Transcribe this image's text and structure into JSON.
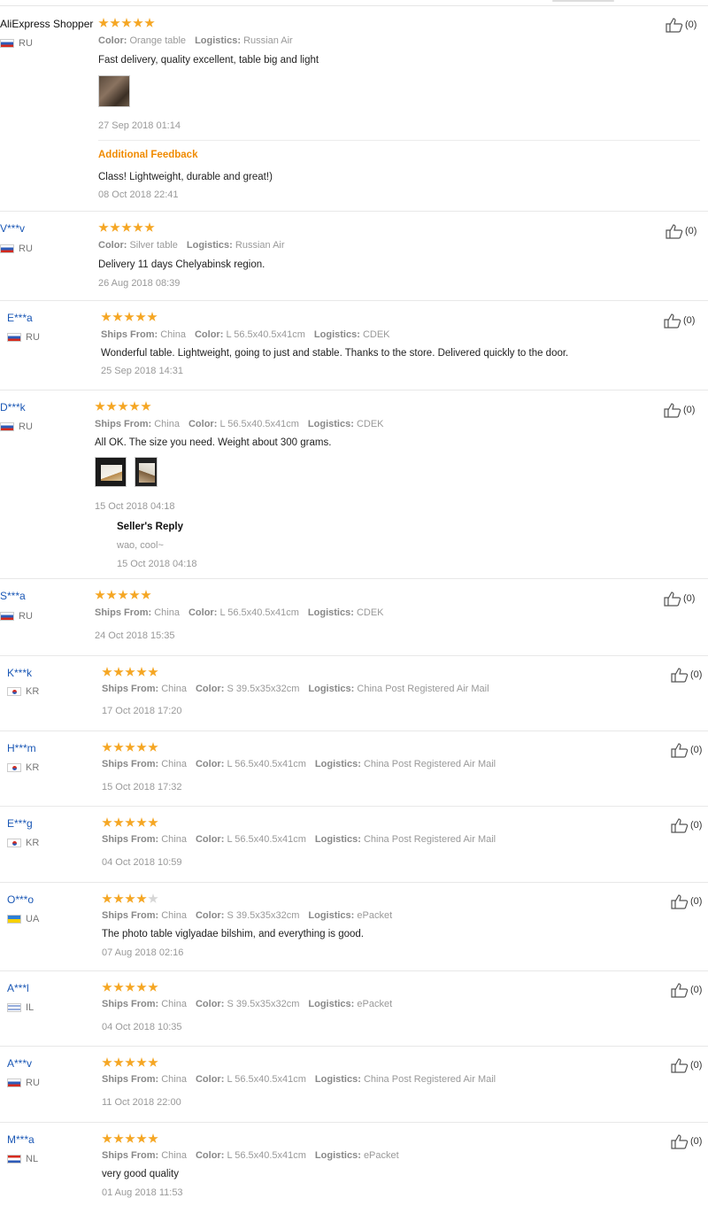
{
  "helpful_label": "(0)",
  "reviews": [
    {
      "top": 0,
      "user": "AliExpress Shopper",
      "user_style": "dark",
      "flag": "ru",
      "country": "RU",
      "rating": 5,
      "info_text": "Color: Orange table   Logistics: Russian Air",
      "info": [
        {
          "label": "Color:",
          "value": "Orange table"
        },
        {
          "label": "Logistics:",
          "value": "Russian Air"
        }
      ],
      "text": "Fast delivery, quality excellent, table big and light",
      "date": "27 Sep 2018 01:14",
      "additional_feedback_label": "Additional Feedback",
      "additional_text": "Class! Lightweight, durable and great!)",
      "additional_date": "08 Oct 2018 22:41"
    },
    {
      "user": "V***v",
      "flag": "ru",
      "country": "RU",
      "rating": 5,
      "info": [
        {
          "label": "Color:",
          "value": "Silver table"
        },
        {
          "label": "Logistics:",
          "value": "Russian Air"
        }
      ],
      "text": "Delivery 11 days Chelyabinsk region.",
      "date": "26 Aug 2018 08:39"
    },
    {
      "user": "E***a",
      "flag": "ru",
      "country": "RU",
      "rating": 5,
      "info": [
        {
          "label": "Ships From:",
          "value": "China"
        },
        {
          "label": "Color:",
          "value": "L 56.5x40.5x41cm"
        },
        {
          "label": "Logistics:",
          "value": "CDEK"
        }
      ],
      "text": "Wonderful table. Lightweight, going to just and stable. Thanks to the store. Delivered quickly to the door.",
      "date": "25 Sep 2018 14:31"
    },
    {
      "user": "D***k",
      "flag": "ru",
      "country": "RU",
      "rating": 5,
      "info": [
        {
          "label": "Ships From:",
          "value": "China"
        },
        {
          "label": "Color:",
          "value": "L 56.5x40.5x41cm"
        },
        {
          "label": "Logistics:",
          "value": "CDEK"
        }
      ],
      "text": "All OK. The size you need. Weight about 300 grams.",
      "date": "15 Oct 2018 04:18",
      "seller_reply_label": "Seller's Reply",
      "seller_reply_text": "wao, cool~",
      "seller_reply_date": "15 Oct 2018 04:18"
    },
    {
      "user": "S***a",
      "flag": "ru",
      "country": "RU",
      "rating": 5,
      "info": [
        {
          "label": "Ships From:",
          "value": "China"
        },
        {
          "label": "Color:",
          "value": "L 56.5x40.5x41cm"
        },
        {
          "label": "Logistics:",
          "value": "CDEK"
        }
      ],
      "date": "24 Oct 2018 15:35"
    },
    {
      "user": "K***k",
      "flag": "kr",
      "country": "KR",
      "rating": 5,
      "info": [
        {
          "label": "Ships From:",
          "value": "China"
        },
        {
          "label": "Color:",
          "value": "S 39.5x35x32cm"
        },
        {
          "label": "Logistics:",
          "value": "China Post Registered Air Mail"
        }
      ],
      "date": "17 Oct 2018 17:20"
    },
    {
      "user": "H***m",
      "flag": "kr",
      "country": "KR",
      "rating": 5,
      "info": [
        {
          "label": "Ships From:",
          "value": "China"
        },
        {
          "label": "Color:",
          "value": "L 56.5x40.5x41cm"
        },
        {
          "label": "Logistics:",
          "value": "China Post Registered Air Mail"
        }
      ],
      "date": "15 Oct 2018 17:32"
    },
    {
      "user": "E***g",
      "flag": "kr",
      "country": "KR",
      "rating": 5,
      "info": [
        {
          "label": "Ships From:",
          "value": "China"
        },
        {
          "label": "Color:",
          "value": "L 56.5x40.5x41cm"
        },
        {
          "label": "Logistics:",
          "value": "China Post Registered Air Mail"
        }
      ],
      "date": "04 Oct 2018 10:59"
    },
    {
      "user": "O***o",
      "flag": "ua",
      "country": "UA",
      "rating": 4,
      "info": [
        {
          "label": "Ships From:",
          "value": "China"
        },
        {
          "label": "Color:",
          "value": "S 39.5x35x32cm"
        },
        {
          "label": "Logistics:",
          "value": "ePacket"
        }
      ],
      "text": "The photo table viglyadae bilshim, and everything is good.",
      "date": "07 Aug 2018 02:16"
    },
    {
      "user": "A***l",
      "flag": "il",
      "country": "IL",
      "rating": 5,
      "info": [
        {
          "label": "Ships From:",
          "value": "China"
        },
        {
          "label": "Color:",
          "value": "S 39.5x35x32cm"
        },
        {
          "label": "Logistics:",
          "value": "ePacket"
        }
      ],
      "date": "04 Oct 2018 10:35"
    },
    {
      "user": "A***v",
      "flag": "ru",
      "country": "RU",
      "rating": 5,
      "info": [
        {
          "label": "Ships From:",
          "value": "China"
        },
        {
          "label": "Color:",
          "value": "L 56.5x40.5x41cm"
        },
        {
          "label": "Logistics:",
          "value": "China Post Registered Air Mail"
        }
      ],
      "date": "11 Oct 2018 22:00"
    },
    {
      "user": "M***a",
      "flag": "nl",
      "country": "NL",
      "rating": 5,
      "info": [
        {
          "label": "Ships From:",
          "value": "China"
        },
        {
          "label": "Color:",
          "value": "L 56.5x40.5x41cm"
        },
        {
          "label": "Logistics:",
          "value": "ePacket"
        }
      ],
      "text": "very good quality",
      "date": "01 Aug 2018 11:53"
    }
  ],
  "colors": {
    "star_on": "#f5a623",
    "star_off": "#d6d6d6",
    "user_link": "#1a57b5",
    "additional_feedback": "#f08a00"
  }
}
